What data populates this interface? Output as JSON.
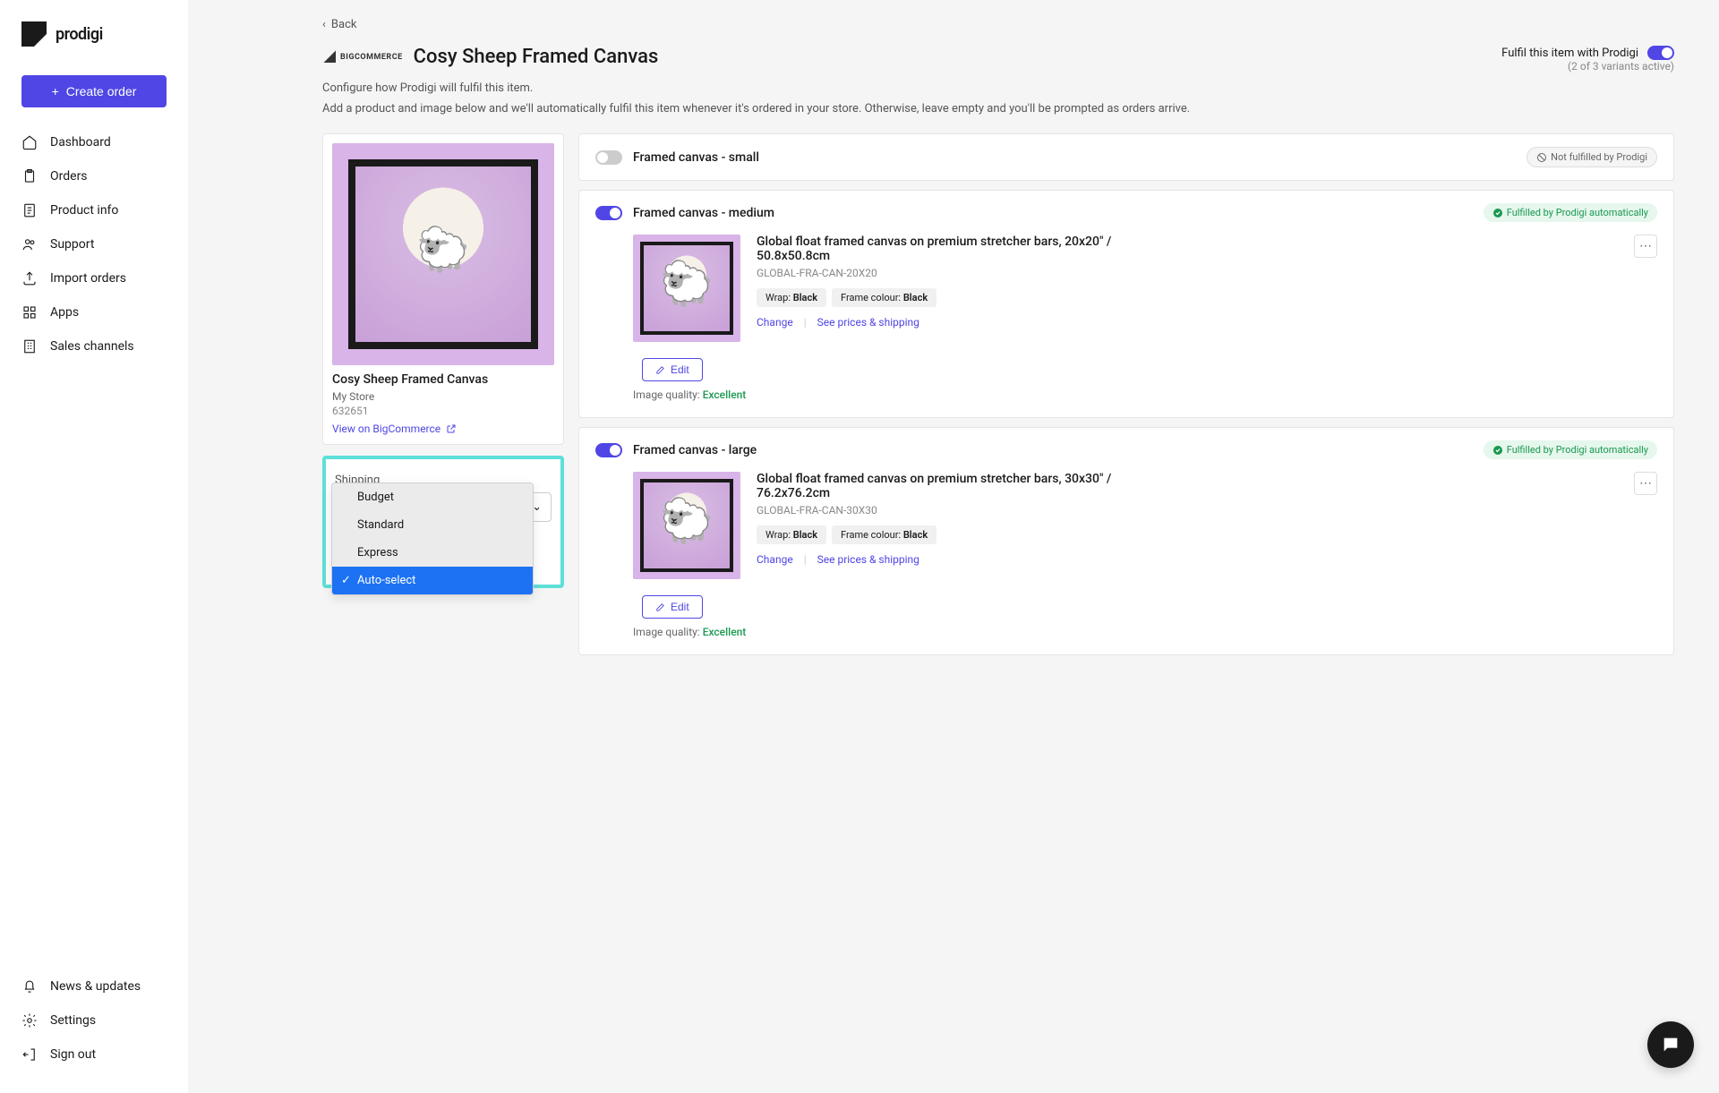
{
  "brand": "prodigi",
  "create_order": "Create order",
  "nav": {
    "dashboard": "Dashboard",
    "orders": "Orders",
    "product_info": "Product info",
    "support": "Support",
    "import_orders": "Import orders",
    "apps": "Apps",
    "sales_channels": "Sales channels",
    "news": "News & updates",
    "settings": "Settings",
    "sign_out": "Sign out"
  },
  "back": "Back",
  "integration_badge": "BIGCOMMERCE",
  "page_title": "Cosy Sheep Framed Canvas",
  "fulfil_label": "Fulfil this item with Prodigi",
  "fulfil_sub": "(2 of 3 variants active)",
  "desc1": "Configure how Prodigi will fulfil this item.",
  "desc2": "Add a product and image below and we'll automatically fulfil this item whenever it's ordered in your store. Otherwise, leave empty and you'll be prompted as orders arrive.",
  "product": {
    "name": "Cosy Sheep Framed Canvas",
    "store": "My Store",
    "sku": "632651",
    "link": "View on BigCommerce"
  },
  "shipping": {
    "label": "Shipping",
    "options": [
      "Budget",
      "Standard",
      "Express",
      "Auto-select"
    ],
    "selected": "Auto-select"
  },
  "badges": {
    "not": "Not fulfilled by Prodigi",
    "auto": "Fulfilled by Prodigi automatically"
  },
  "common": {
    "change": "Change",
    "prices": "See prices & shipping",
    "edit": "Edit",
    "quality_label": "Image quality: ",
    "quality_value": "Excellent",
    "wrap_label": "Wrap: ",
    "frame_label": "Frame colour: "
  },
  "variants": [
    {
      "title": "Framed canvas - small",
      "on": false
    },
    {
      "title": "Framed canvas - medium",
      "on": true,
      "name": "Global float framed canvas on premium stretcher bars, 20x20\" / 50.8x50.8cm",
      "sku": "GLOBAL-FRA-CAN-20X20",
      "wrap": "Black",
      "frame": "Black"
    },
    {
      "title": "Framed canvas - large",
      "on": true,
      "name": "Global float framed canvas on premium stretcher bars, 30x30\" / 76.2x76.2cm",
      "sku": "GLOBAL-FRA-CAN-30X30",
      "wrap": "Black",
      "frame": "Black"
    }
  ]
}
